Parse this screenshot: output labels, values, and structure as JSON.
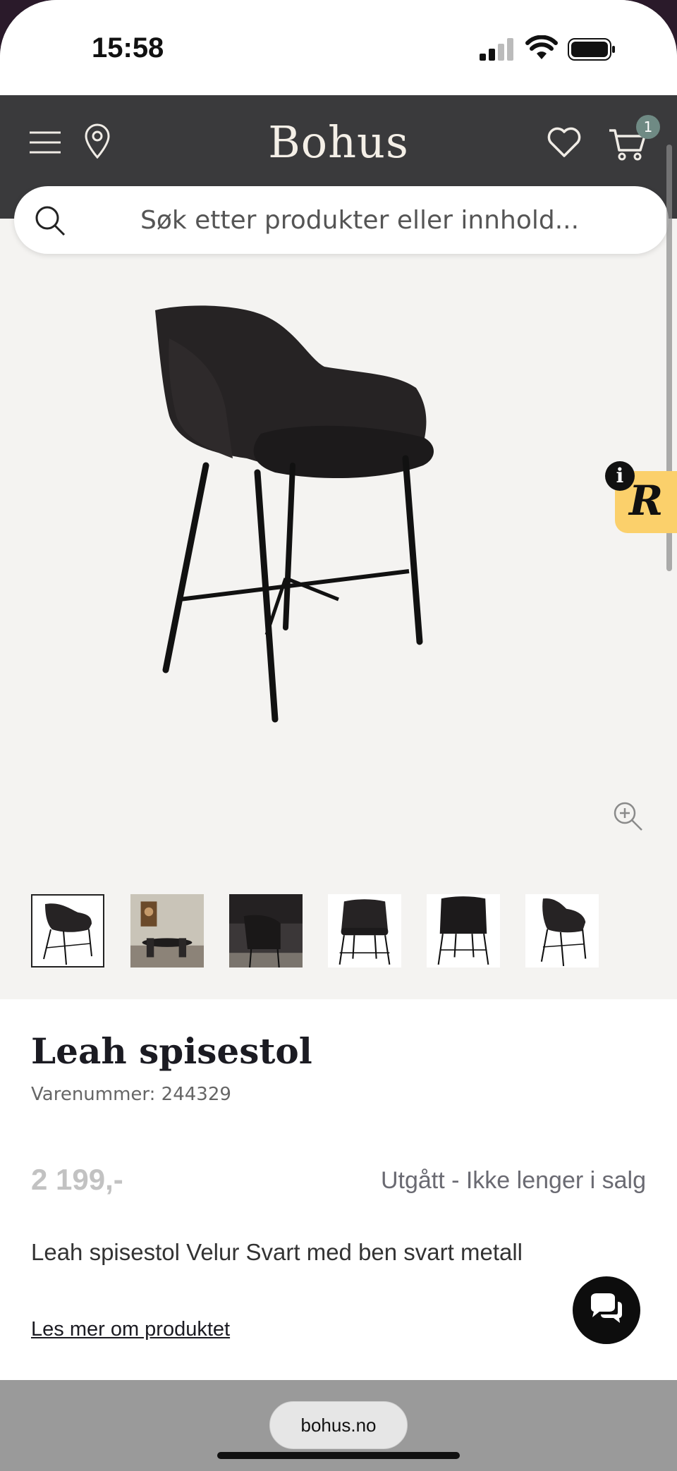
{
  "status_bar": {
    "time": "15:58"
  },
  "header": {
    "logo": "Bohus",
    "cart_count": "1"
  },
  "search": {
    "placeholder": "Søk etter produkter eller innhold..."
  },
  "product": {
    "title": "Leah spisestol",
    "sku": "Varenummer: 244329",
    "price": "2 199,-",
    "availability": "Utgått - Ikke lenger i salg",
    "description": "Leah spisestol Velur Svart med ben svart metall",
    "read_more": "Les mer om produktet"
  },
  "widget": {
    "letter": "R",
    "info": "i"
  },
  "browser": {
    "url": "bohus.no"
  },
  "colors": {
    "header_bg": "#3a3a3c",
    "badge": "#6f8a84",
    "widget": "#fbd06b"
  },
  "icons": [
    "menu-icon",
    "location-icon",
    "heart-icon",
    "cart-icon",
    "search-icon",
    "zoom-icon",
    "chat-icon",
    "info-icon"
  ]
}
